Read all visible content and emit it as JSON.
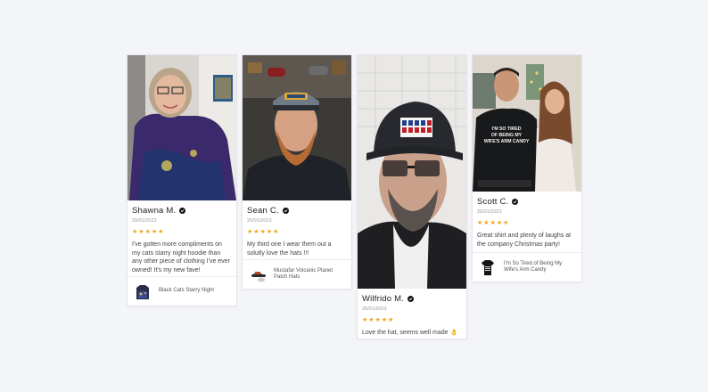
{
  "reviews": [
    {
      "name": "Shawna M.",
      "date": "20/01/2023",
      "rating": 5,
      "text": "I've gotten more compliments on my cats starry night hoodie than any other piece of clothing I've ever owned! It's my new fave!",
      "product": "Black Cats Starry Night"
    },
    {
      "name": "Sean C.",
      "date": "25/01/2023",
      "rating": 5,
      "text": "My third one I wear them out a solutly love the hats !!!",
      "product": "Mustafar Volcanic Planet Patch Hats"
    },
    {
      "name": "Wilfrido M.",
      "date": "25/01/2023",
      "rating": 5,
      "text": "Love the hat, seems well made 👌"
    },
    {
      "name": "Scott C.",
      "date": "20/01/2023",
      "rating": 5,
      "text": "Great shirt and plenty of laughs at the company Christmas party!",
      "product": "I'm So Tired of Being My Wife's Arm Candy",
      "shirt_print": "I'M SO TIRED OF BEING MY WIFE'S ARM CANDY"
    }
  ],
  "colors": {
    "star": "#f2a516",
    "background": "#f4f5f9",
    "card_border": "#e4e5ea"
  }
}
